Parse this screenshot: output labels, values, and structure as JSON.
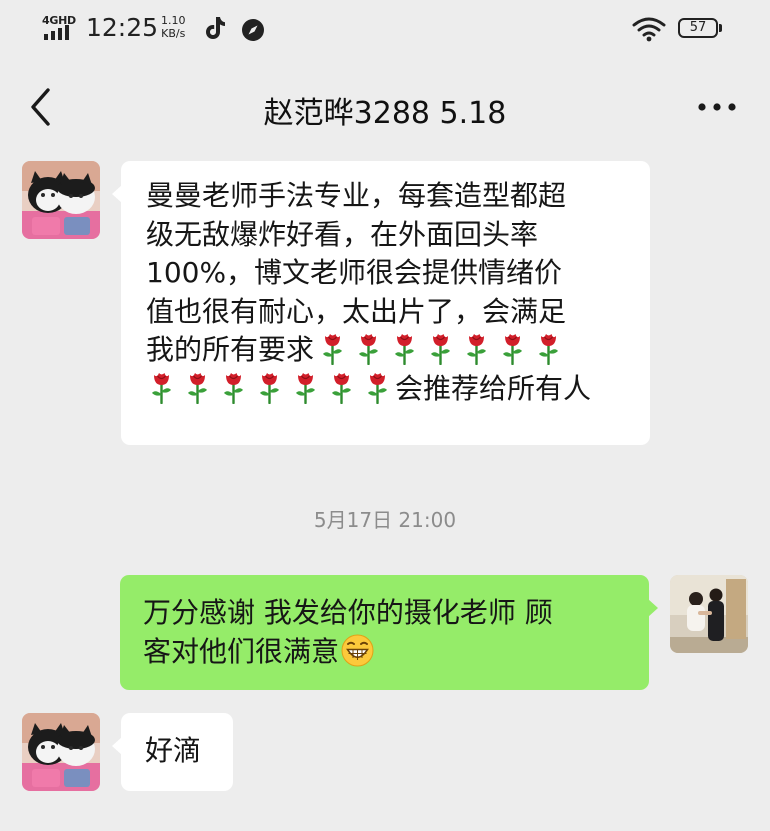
{
  "status_bar": {
    "network": "4GHD",
    "time": "12:25",
    "net_speed_value": "1.10",
    "net_speed_unit": "KB/s",
    "battery": "57"
  },
  "nav": {
    "title": "赵范晔3288 5.18",
    "back_icon": "chevron-left-icon",
    "more_icon": "more-dots-icon"
  },
  "messages": [
    {
      "direction": "incoming",
      "line_1": "曼曼老师手法专业，每套造型都超",
      "line_2": "级无敌爆炸好看，在外面回头率",
      "line_3": "100%，博文老师很会提供情绪价",
      "line_4": "值也很有耐心，太出片了，会满足",
      "line_5": "我的所有要求",
      "line_6_suffix": "会推荐给所有人",
      "emoji": "rose-icon",
      "emoji_count_line_5": 7,
      "emoji_count_line_6": 7
    },
    {
      "direction": "timestamp",
      "text": "5月17日 21:00"
    },
    {
      "direction": "outgoing",
      "line_1": "万分感谢 我发给你的摄化老师 顾",
      "line_2": "客对他们很满意",
      "emoji": "grinning-face-icon"
    },
    {
      "direction": "incoming",
      "line_1": "好滴"
    }
  ],
  "colors": {
    "background": "#ededed",
    "incoming_bubble": "#ffffff",
    "outgoing_bubble": "#95ec69",
    "timestamp_text": "#8c8c8c"
  }
}
